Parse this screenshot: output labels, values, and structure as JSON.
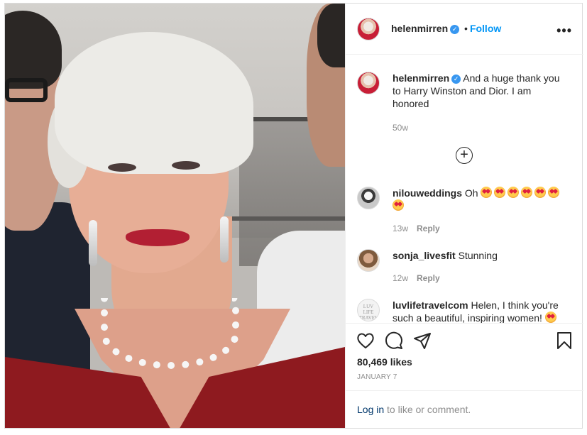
{
  "post": {
    "author": "helenmirren",
    "follow_label": "Follow",
    "separator": "•",
    "more_icon": "more-options-icon"
  },
  "caption": {
    "username": "helenmirren",
    "text": "And a huge thank you to Harry Winston and Dior. I am honored",
    "age": "50w"
  },
  "load_more_icon": "plus-circle-icon",
  "comments": [
    {
      "username": "nilouweddings",
      "text": "Oh",
      "emoji": "heart-eyes",
      "emoji_count": 7,
      "age": "13w",
      "reply_label": "Reply"
    },
    {
      "username": "sonja_livesfit",
      "text": "Stunning",
      "age": "12w",
      "reply_label": "Reply"
    },
    {
      "username": "luvlifetravelcom",
      "text": "Helen, I think you're such a beautiful, inspiring women!",
      "avatar_text": "LUV LIFE TRAVEL"
    }
  ],
  "actions": {
    "icons": [
      "heart-icon",
      "comment-icon",
      "share-icon",
      "bookmark-icon"
    ],
    "likes": "80,469 likes",
    "date": "JANUARY 7"
  },
  "login": {
    "link": "Log in",
    "rest": "to like or comment."
  },
  "colors": {
    "link_blue": "#0095f6",
    "verified_blue": "#3897f0",
    "muted": "#8e8e8e",
    "text": "#262626"
  }
}
